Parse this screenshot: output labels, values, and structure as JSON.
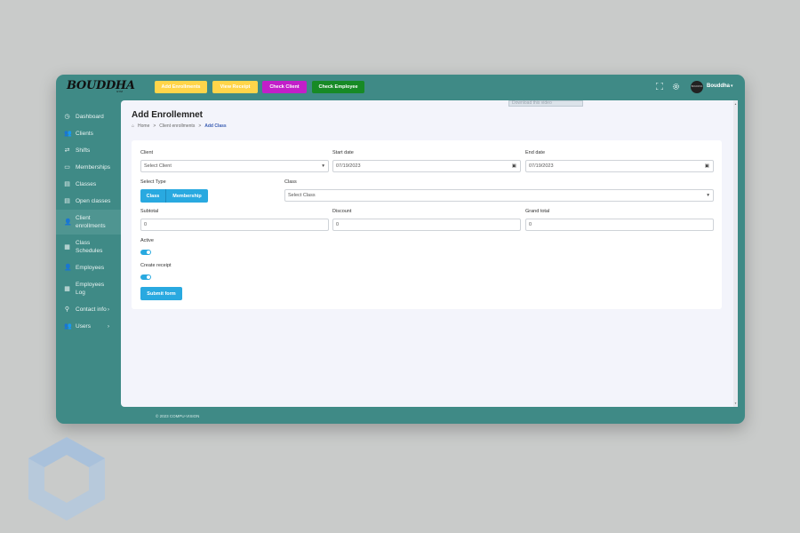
{
  "header": {
    "logo_text": "BOUDDHA",
    "logo_sub": "GYM",
    "buttons": {
      "add_enrollments": "Add Enrollments",
      "view_receipt": "View Receipt",
      "check_client": "Check Client",
      "check_employee": "Check Employee"
    },
    "avatar_text": "BOUDDHA",
    "username": "Bouddha",
    "icons": [
      "fullscreen-icon",
      "gear-icon",
      "chevron-down-icon"
    ]
  },
  "sidebar": {
    "items": [
      {
        "label": "Dashboard",
        "icon": "clock-icon"
      },
      {
        "label": "Clients",
        "icon": "users-icon"
      },
      {
        "label": "Shifts",
        "icon": "arrows-icon"
      },
      {
        "label": "Memberships",
        "icon": "card-icon"
      },
      {
        "label": "Classes",
        "icon": "layers-icon"
      },
      {
        "label": "Open classes",
        "icon": "layers-icon"
      },
      {
        "label": "Client enrollments",
        "icon": "user-plus-icon"
      },
      {
        "label": "Class Schedules",
        "icon": "calendar-icon"
      },
      {
        "label": "Employees",
        "icon": "user-icon"
      },
      {
        "label": "Employees Log",
        "icon": "calendar-icon"
      },
      {
        "label": "Contact info",
        "icon": "pin-icon",
        "arrow": "›"
      },
      {
        "label": "Users",
        "icon": "users-icon",
        "arrow": "›"
      }
    ]
  },
  "page": {
    "title": "Add Enrollemnet",
    "breadcrumb": {
      "home": "Home",
      "sep": ">",
      "parent": "Client enrollments",
      "current": "Add Class"
    },
    "download_video": "Download this video"
  },
  "form": {
    "client_label": "Client",
    "client_value": "Select Client",
    "start_label": "Start date",
    "start_value": "07/19/2023",
    "end_label": "End date",
    "end_value": "07/19/2023",
    "type_label": "Select Type",
    "type_options": [
      "Class",
      "Membership"
    ],
    "class_label": "Class",
    "class_value": "Select Class",
    "subtotal_label": "Subtotal",
    "subtotal_value": "0",
    "discount_label": "Discount",
    "discount_value": "0",
    "grand_label": "Grand total",
    "grand_value": "0",
    "active_label": "Active",
    "active_on": true,
    "receipt_label": "Create receipt",
    "receipt_on": true,
    "submit_label": "Submit form"
  },
  "footer": {
    "text": "© 2023 COMPU-VISION"
  },
  "colors": {
    "teal": "#3f8a86",
    "accent": "#29a9e0",
    "yellow": "#ffd54a",
    "purple": "#c21fc9",
    "green": "#178a25"
  }
}
